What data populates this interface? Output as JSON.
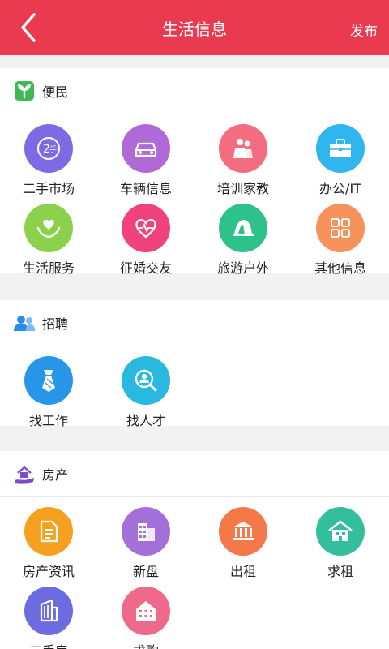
{
  "header": {
    "title": "生活信息",
    "publish_label": "发布"
  },
  "sections": [
    {
      "title": "便民",
      "items": [
        {
          "label": "二手市场",
          "icon": "second-hand-icon",
          "color": "#7f6ae6"
        },
        {
          "label": "车辆信息",
          "icon": "car-icon",
          "color": "#b06ad8"
        },
        {
          "label": "培训家教",
          "icon": "tutoring-icon",
          "color": "#f36c7f"
        },
        {
          "label": "办公/IT",
          "icon": "briefcase-icon",
          "color": "#2fb6ef"
        },
        {
          "label": "生活服务",
          "icon": "heart-hands-icon",
          "color": "#8bd14b"
        },
        {
          "label": "征婚交友",
          "icon": "heart-icon",
          "color": "#f0437d"
        },
        {
          "label": "旅游户外",
          "icon": "tent-icon",
          "color": "#2ec28b"
        },
        {
          "label": "其他信息",
          "icon": "grid-icon",
          "color": "#f6925a"
        }
      ]
    },
    {
      "title": "招聘",
      "items": [
        {
          "label": "找工作",
          "icon": "tie-icon",
          "color": "#2796e8"
        },
        {
          "label": "找人才",
          "icon": "talent-search-icon",
          "color": "#29b8e0"
        }
      ]
    },
    {
      "title": "房产",
      "items": [
        {
          "label": "房产资讯",
          "icon": "document-icon",
          "color": "#f6a01f"
        },
        {
          "label": "新盘",
          "icon": "building-icon",
          "color": "#a36fd8"
        },
        {
          "label": "出租",
          "icon": "bank-icon",
          "color": "#f47848"
        },
        {
          "label": "求租",
          "icon": "house-icon",
          "color": "#33bf9c"
        },
        {
          "label": "二手房",
          "icon": "building-icon",
          "color": "#6c6ce0"
        },
        {
          "label": "求购",
          "icon": "apartment-icon",
          "color": "#ef6a8a"
        }
      ]
    }
  ]
}
